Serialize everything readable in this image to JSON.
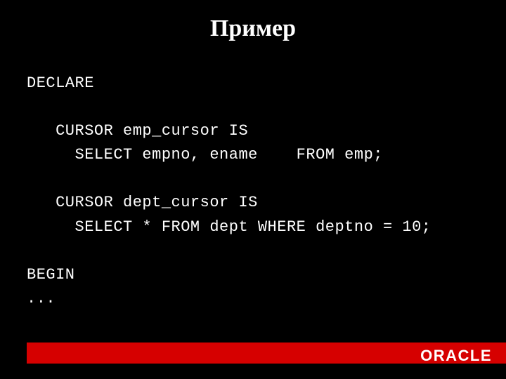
{
  "slide": {
    "title": "Пример",
    "code": "DECLARE\n\n   CURSOR emp_cursor IS\n     SELECT empno, ename    FROM emp;\n\n   CURSOR dept_cursor IS\n     SELECT * FROM dept WHERE deptno = 10;\n\nBEGIN\n...",
    "footer_logo": "ORACLE"
  }
}
